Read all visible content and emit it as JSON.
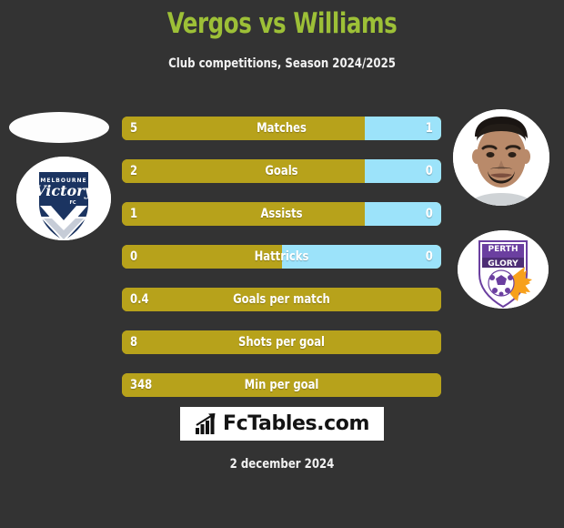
{
  "header": {
    "title": "Vergos vs Williams",
    "subtitle": "Club competitions, Season 2024/2025",
    "title_color": "#9dc037",
    "subtitle_color": "#f2f2f2"
  },
  "colors": {
    "background": "#333333",
    "home_bar": "#b7a21b",
    "away_bar": "#9ce3fa",
    "bar_text": "#ffffff"
  },
  "media": {
    "left_player_photo": "player-photo-placeholder",
    "left_club_logo": "melbourne-victory-fc-logo",
    "right_player_photo": "player-photo-williams",
    "right_club_logo": "perth-glory-fc-logo"
  },
  "chart_data": {
    "type": "bar",
    "title": "Vergos vs Williams",
    "subtitle": "Club competitions, Season 2024/2025",
    "orientation": "horizontal-split",
    "series": [
      {
        "name": "Vergos",
        "club": "Melbourne Victory",
        "color": "#b7a21b"
      },
      {
        "name": "Williams",
        "club": "Perth Glory",
        "color": "#9ce3fa"
      }
    ],
    "categories": [
      "Matches",
      "Goals",
      "Assists",
      "Hattricks",
      "Goals per match",
      "Shots per goal",
      "Min per goal"
    ],
    "rows": [
      {
        "label": "Matches",
        "left": "5",
        "right": "1",
        "left_pct": 76,
        "right_pct": 24,
        "has_right": true
      },
      {
        "label": "Goals",
        "left": "2",
        "right": "0",
        "left_pct": 76,
        "right_pct": 24,
        "has_right": true
      },
      {
        "label": "Assists",
        "left": "1",
        "right": "0",
        "left_pct": 76,
        "right_pct": 24,
        "has_right": true
      },
      {
        "label": "Hattricks",
        "left": "0",
        "right": "0",
        "left_pct": 50,
        "right_pct": 50,
        "has_right": true
      },
      {
        "label": "Goals per match",
        "left": "0.4",
        "right": "",
        "left_pct": 100,
        "right_pct": 0,
        "has_right": false
      },
      {
        "label": "Shots per goal",
        "left": "8",
        "right": "",
        "left_pct": 100,
        "right_pct": 0,
        "has_right": false
      },
      {
        "label": "Min per goal",
        "left": "348",
        "right": "",
        "left_pct": 100,
        "right_pct": 0,
        "has_right": false
      }
    ]
  },
  "brand": {
    "name": "FcTables.com",
    "icon": "bar-chart-arrow-icon"
  },
  "footer": {
    "date": "2 december 2024"
  }
}
